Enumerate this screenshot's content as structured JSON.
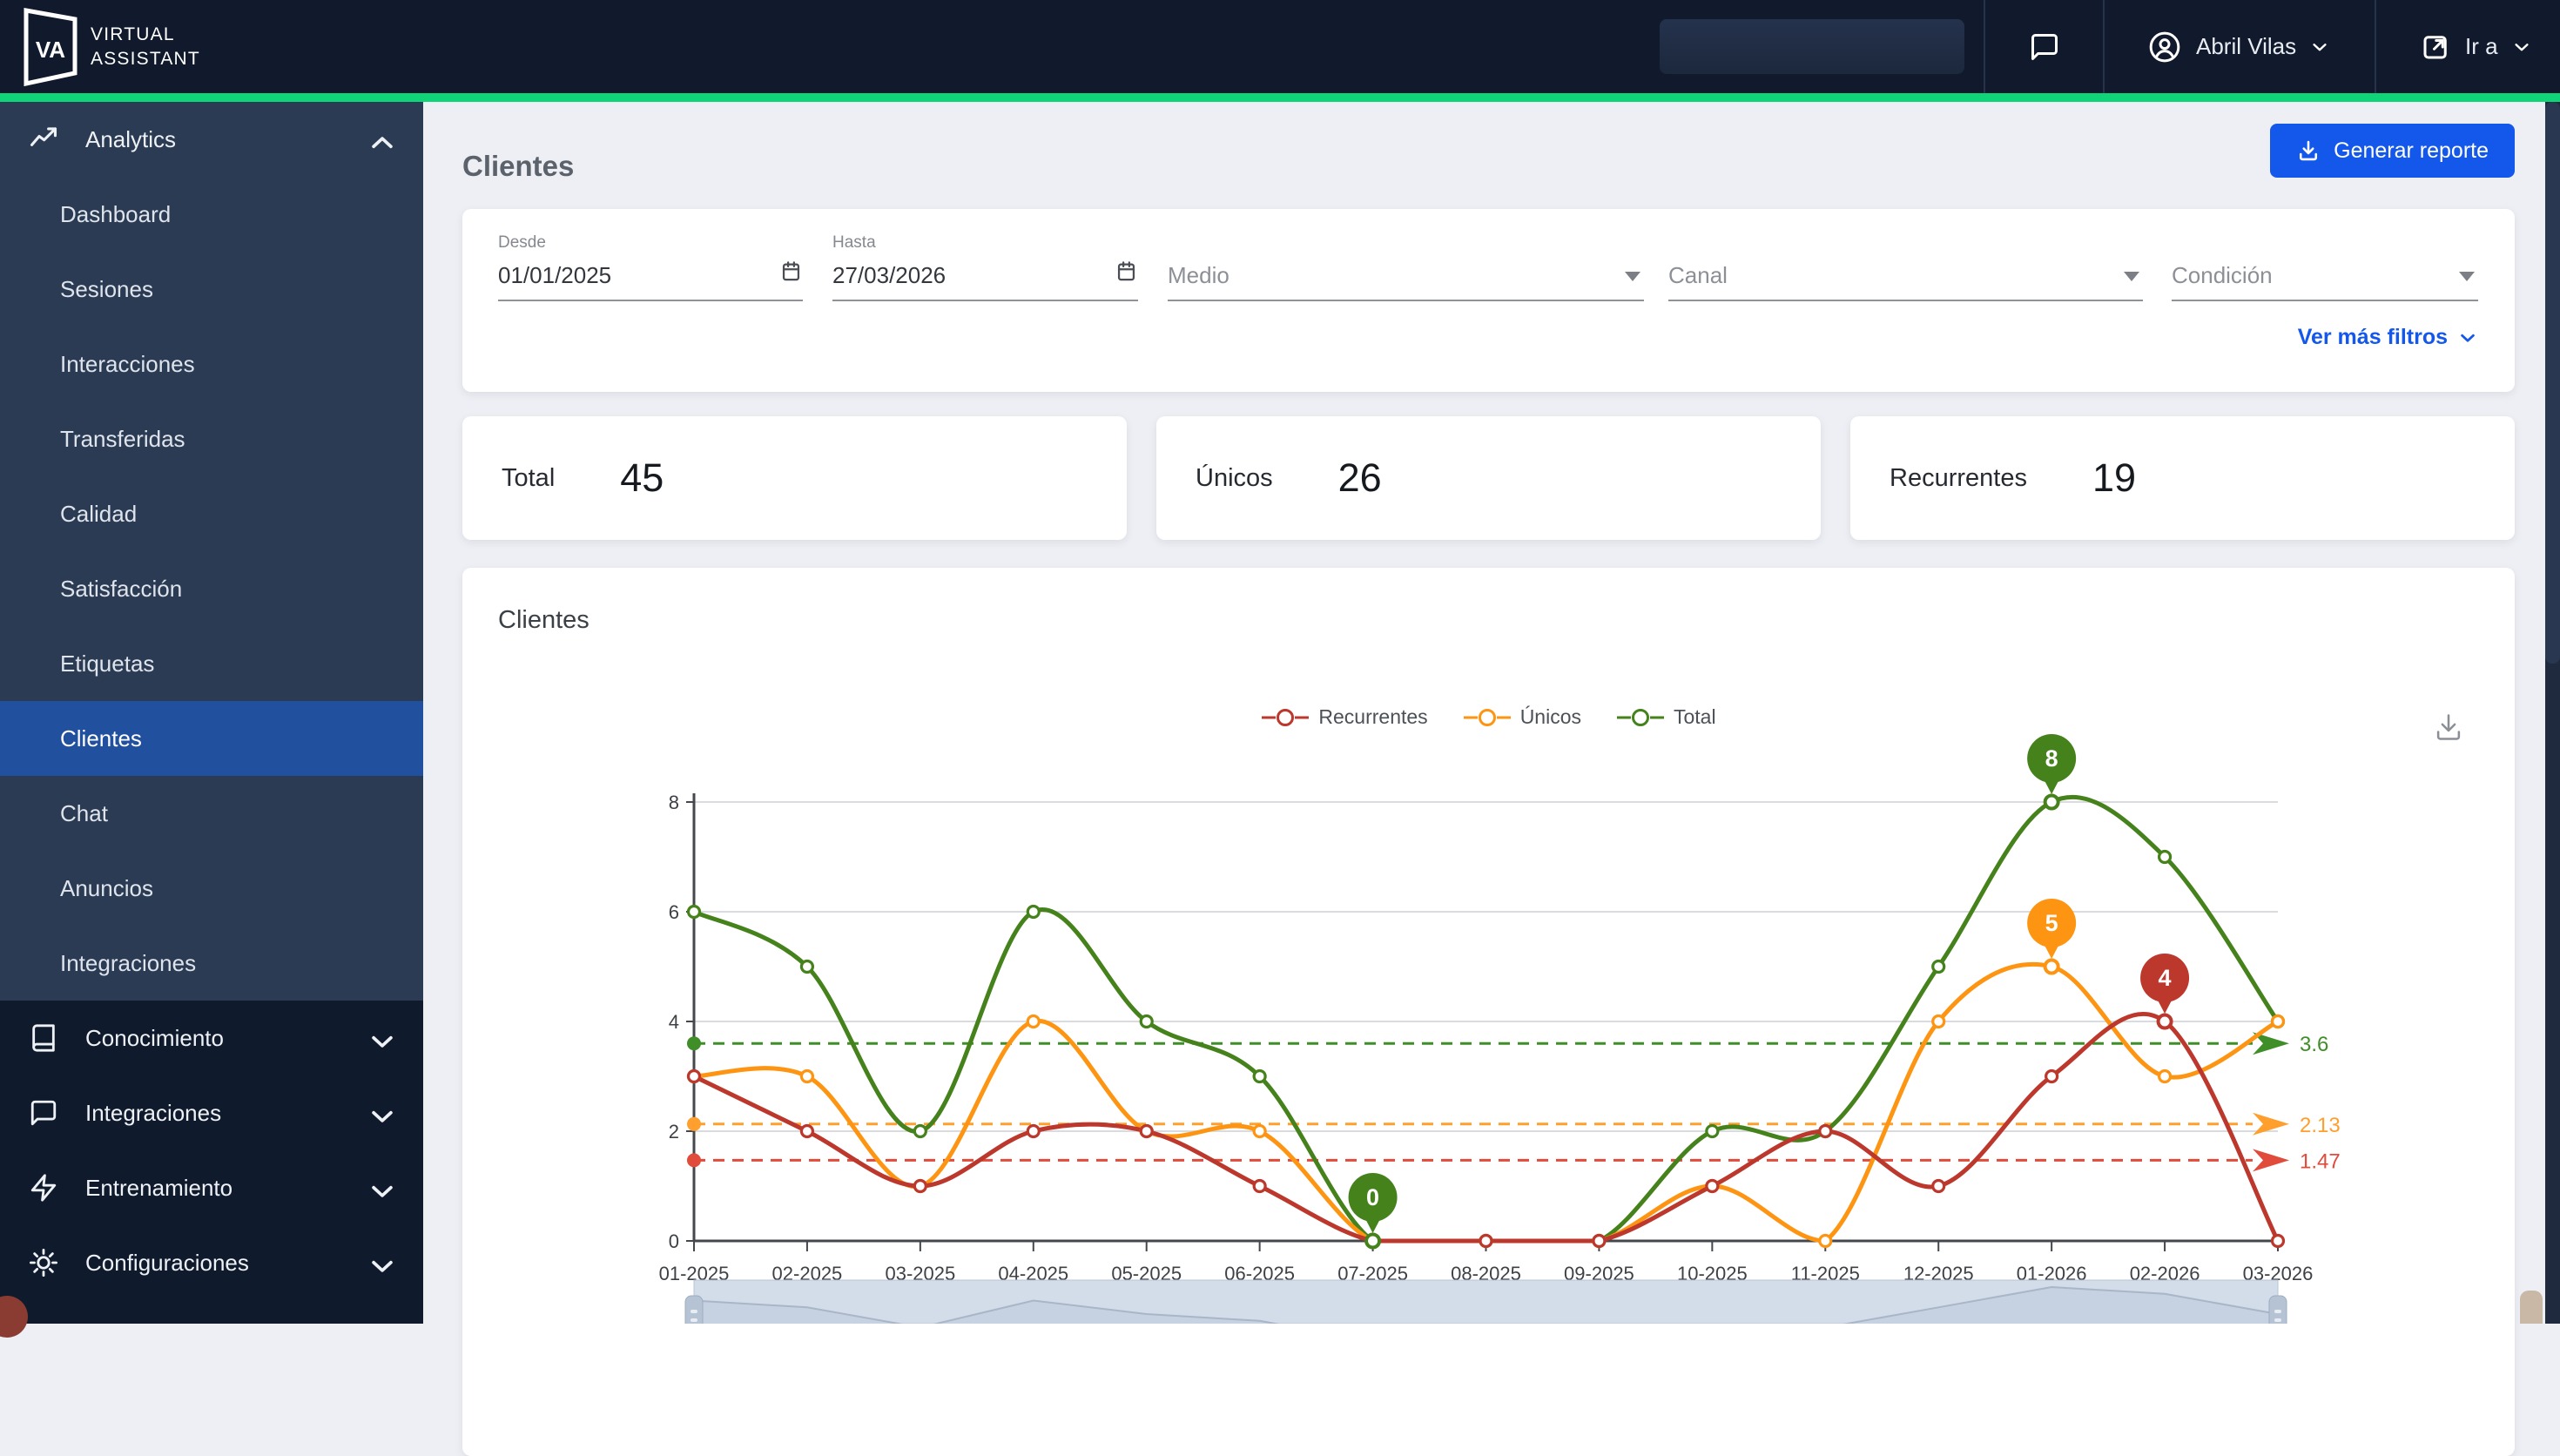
{
  "nav": {
    "brand_acronym": "VA",
    "brand_lines": [
      "VIRTUAL",
      "ASSISTANT"
    ],
    "user_name": "Abril Vilas",
    "go_to_label": "Ir a"
  },
  "sidebar": {
    "selected": "Clientes",
    "sections": [
      {
        "label": "Analytics",
        "icon": "line-chart",
        "expanded": true,
        "items": [
          "Dashboard",
          "Sesiones",
          "Interacciones",
          "Transferidas",
          "Calidad",
          "Satisfacción",
          "Etiquetas",
          "Clientes",
          "Chat",
          "Anuncios",
          "Integraciones"
        ]
      },
      {
        "label": "Conocimiento",
        "icon": "book"
      },
      {
        "label": "Integraciones",
        "icon": "chat"
      },
      {
        "label": "Entrenamiento",
        "icon": "bolt"
      },
      {
        "label": "Configuraciones",
        "icon": "gear"
      }
    ]
  },
  "page": {
    "title": "Clientes",
    "report_button": "Generar reporte"
  },
  "filters": {
    "date_fields": [
      {
        "label": "Desde",
        "value": "01/01/2025"
      },
      {
        "label": "Hasta",
        "value": "27/03/2026"
      }
    ],
    "selects": [
      "Medio",
      "Canal",
      "Condición"
    ],
    "more_label": "Ver más filtros"
  },
  "stats": [
    {
      "label": "Total",
      "value": "45"
    },
    {
      "label": "Únicos",
      "value": "26"
    },
    {
      "label": "Recurrentes",
      "value": "19"
    }
  ],
  "chart_data": {
    "type": "line",
    "title": "Clientes",
    "categories": [
      "01-2025",
      "02-2025",
      "03-2025",
      "04-2025",
      "05-2025",
      "06-2025",
      "07-2025",
      "08-2025",
      "09-2025",
      "10-2025",
      "11-2025",
      "12-2025",
      "01-2026",
      "02-2026",
      "03-2026"
    ],
    "series": [
      {
        "name": "Recurrentes",
        "color": "#bc372c",
        "dash_color": "#e14b3c",
        "values": [
          3,
          2,
          1,
          2,
          2,
          1,
          0,
          0,
          0,
          1,
          2,
          1,
          3,
          4,
          0
        ],
        "average": 1.47,
        "average_label": "1.47"
      },
      {
        "name": "Únicos",
        "color": "#fd9513",
        "dash_color": "#ff9f2e",
        "values": [
          3,
          3,
          1,
          4,
          2,
          2,
          0,
          0,
          0,
          1,
          0,
          4,
          5,
          3,
          4
        ],
        "average": 2.13,
        "average_label": "2.13"
      },
      {
        "name": "Total",
        "color": "#45821c",
        "dash_color": "#3f8e28",
        "values": [
          6,
          5,
          2,
          6,
          4,
          3,
          0,
          0,
          0,
          2,
          2,
          5,
          8,
          7,
          4
        ],
        "average": 3.6,
        "average_label": "3.6"
      }
    ],
    "annotations": [
      {
        "series": "Total",
        "category": "07-2025",
        "label": "0"
      },
      {
        "series": "Total",
        "category": "01-2026",
        "label": "8"
      },
      {
        "series": "Únicos",
        "category": "01-2026",
        "label": "5"
      },
      {
        "series": "Recurrentes",
        "category": "02-2026",
        "label": "4"
      }
    ],
    "ylim": [
      0,
      8
    ],
    "yticks": [
      0,
      2,
      4,
      6,
      8
    ],
    "grid": true,
    "legend_position": "top-center"
  }
}
